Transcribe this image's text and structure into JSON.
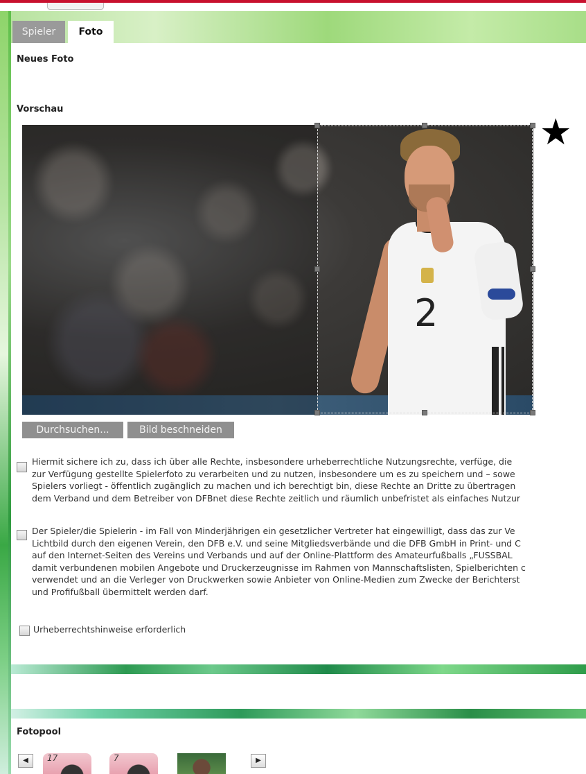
{
  "tabs": [
    {
      "label": "Spieler",
      "active": false
    },
    {
      "label": "Foto",
      "active": true
    }
  ],
  "sections": {
    "new_photo": "Neues Foto",
    "preview": "Vorschau",
    "fotopool": "Fotopool"
  },
  "preview_image": {
    "jersey_number": "2"
  },
  "buttons": {
    "browse": "Durchsuchen...",
    "crop": "Bild beschneiden"
  },
  "consent1": {
    "checked": false,
    "lines": [
      "Hiermit sichere ich zu, dass ich über alle Rechte, insbesondere urheberrechtliche Nutzungsrechte, verfüge, die",
      "zur Verfügung gestellte Spielerfoto zu verarbeiten und zu nutzen, insbesondere um es zu speichern und – sowe",
      "Spielers vorliegt - öffentlich zugänglich zu machen und ich berechtigt bin, diese Rechte an Dritte zu übertragen",
      "dem Verband und dem Betreiber von DFBnet diese Rechte zeitlich und räumlich unbefristet als einfaches Nutzur"
    ]
  },
  "consent2": {
    "checked": false,
    "lines": [
      "Der Spieler/die Spielerin - im Fall von Minderjährigen ein gesetzlicher Vertreter hat eingewilligt, dass das zur Ve",
      "Lichtbild durch den eigenen Verein, den DFB e.V. und seine Mitgliedsverbände und die DFB GmbH in Print- und C",
      "auf den Internet-Seiten des Vereins und Verbands und auf der Online-Plattform des Amateurfußballs „FUSSBAL",
      "damit verbundenen mobilen Angebote und Druckerzeugnisse im Rahmen von Mannschaftslisten, Spielberichten c",
      "verwendet und an die Verleger von Druckwerken sowie Anbieter von Online-Medien zum Zwecke der Berichterst",
      "und Profifußball übermittelt werden darf."
    ]
  },
  "copyright": {
    "checked": false,
    "label": "Urheberrechtshinweise erforderlich"
  },
  "annotation": {
    "star": "★"
  },
  "fotopool": {
    "prev_icon": "◀",
    "next_icon": "▶",
    "thumbnails": [
      {
        "number": "17"
      },
      {
        "number": "7"
      },
      {
        "number": ""
      }
    ]
  },
  "colors": {
    "brand_red": "#c8102e",
    "button_gray": "#8f8f8f",
    "tab_inactive": "#9a9a9a",
    "green_accent": "#2d9a52"
  }
}
